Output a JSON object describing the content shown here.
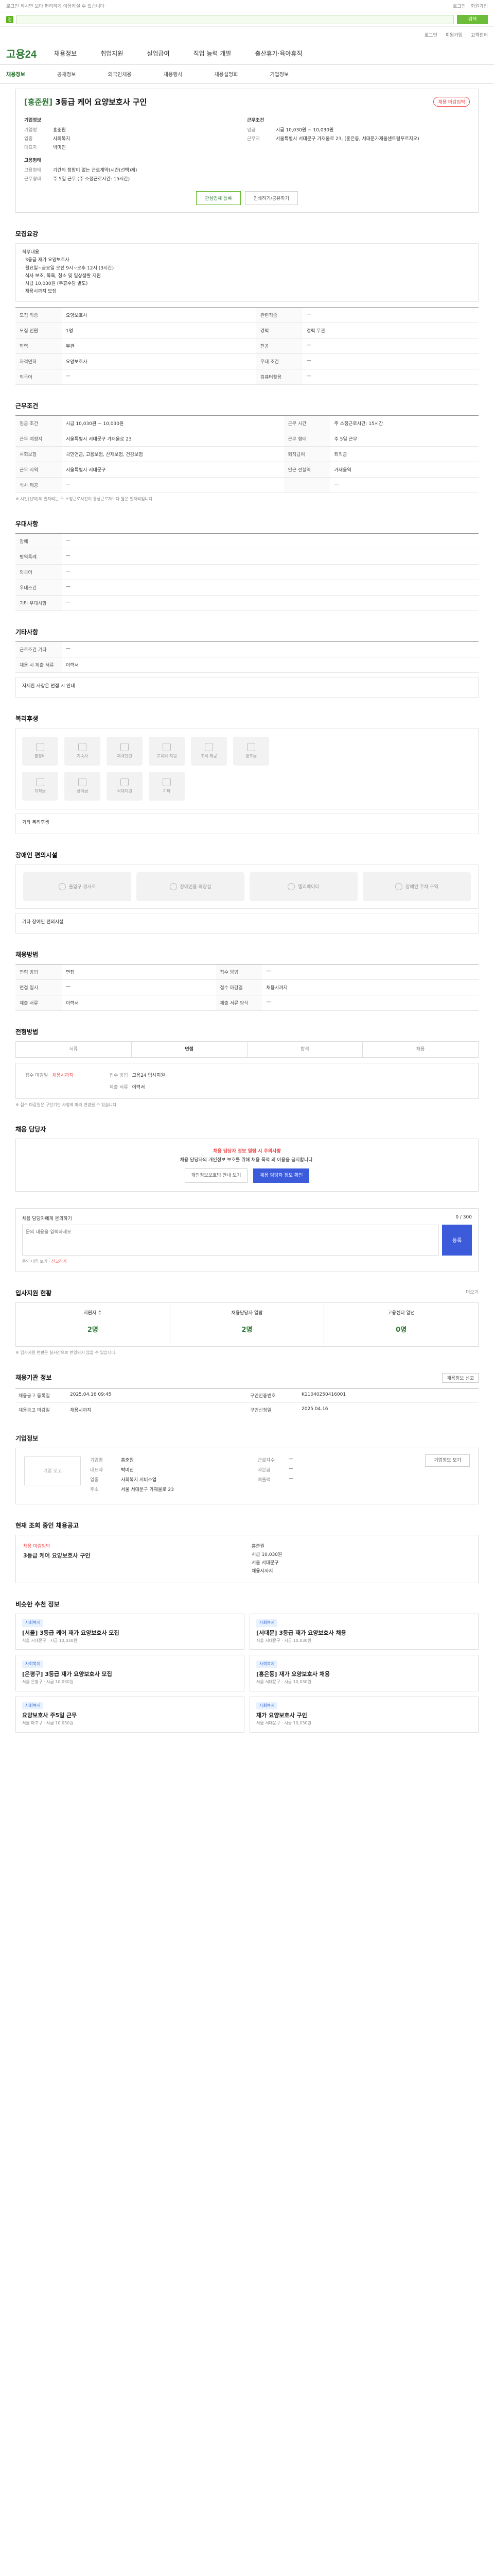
{
  "utility": {
    "left": "로그인 하시면 보다 편리하게 이용하실 수 있습니다",
    "links": [
      "로그인",
      "회원가입"
    ]
  },
  "gbar": {
    "placeholder": "",
    "btn": "검색"
  },
  "hdr": {
    "links": [
      "로그인",
      "회원가입",
      "고객센터"
    ]
  },
  "logo": "고용24",
  "nav": [
    "채용정보",
    "취업지원",
    "실업급여",
    "직업 능력 개발",
    "출산휴가·육아휴직"
  ],
  "subnav": [
    "채용정보",
    "공채정보",
    "외국인채용",
    "채용행사",
    "채용설명회",
    "기업정보"
  ],
  "job": {
    "tag": "[홍준원]",
    "title": "3등급 케어 요양보호사 구인",
    "badge": "채용 마감임박",
    "corp_h": "기업정보",
    "corp": [
      {
        "k": "기업명",
        "v": "홍준원"
      },
      {
        "k": "업종",
        "v": "사회복지"
      },
      {
        "k": "대표자",
        "v": "박미진"
      }
    ],
    "work_h": "근무조건",
    "work": [
      {
        "k": "임금",
        "v": "시급 10,030원 ~ 10,030원"
      },
      {
        "k": "근무지",
        "v": "서울특별시 서대문구 가재울로 23, (홍은동, 서대문가재울센트럴푸르지오)"
      }
    ],
    "req_h": "고용형태",
    "req": [
      {
        "k": "고용형태",
        "v": "기간의 정함이 없는 근로계약(시간(선택)제)"
      },
      {
        "k": "근무형태",
        "v": "주 5일 근무 (주 소정근로시간: 15시간)"
      }
    ],
    "btn1": "관심업체 등록",
    "btn2": "인쇄하기/공유하기"
  },
  "dutySec": {
    "h": "모집요강",
    "intro": "직무내용",
    "items": [
      "· 3등급 재가 요양보호사",
      "· 월요일~금요일 오전 9시~오후 12시 (3시간)",
      "· 식사 보조, 목욕, 청소 및 일상생활 지원",
      "· 시급 10,030원 (주휴수당 별도)",
      "· 채용시까지 모집"
    ],
    "rows": [
      [
        "모집 직종",
        "요양보호사",
        "관련직종",
        "—"
      ],
      [
        "모집 인원",
        "1명",
        "경력",
        "경력 무관"
      ],
      [
        "학력",
        "무관",
        "전공",
        "—"
      ],
      [
        "자격면허",
        "요양보호사",
        "우대 조건",
        "—"
      ],
      [
        "외국어",
        "—",
        "컴퓨터활용",
        "—"
      ]
    ]
  },
  "condSec": {
    "h": "근무조건",
    "rows": [
      [
        "임금 조건",
        "시급 10,030원 ~ 10,030원",
        "근무 시간",
        "주 소정근로시간: 15시간"
      ],
      [
        "근무 예정지",
        "서울특별시 서대문구 가재울로 23",
        "근무 형태",
        "주 5일 근무"
      ],
      [
        "사회보험",
        "국민연금, 고용보험, 산재보험, 건강보험",
        "퇴직급여",
        "퇴직금"
      ],
      [
        "근무 지역",
        "서울특별시 서대문구",
        "인근 전철역",
        "가재울역"
      ],
      [
        "식사 제공",
        "—",
        "",
        "—"
      ]
    ],
    "note": "※ 시간(선택)제 일자리는 주 소정근로시간이 통상근로자보다 짧은 일자리입니다."
  },
  "etcSec": {
    "h": "우대사항",
    "rows": [
      [
        "장애",
        "—"
      ],
      [
        "병역특례",
        "—"
      ],
      [
        "외국어",
        "—"
      ],
      [
        "우대조건",
        "—"
      ],
      [
        "기타 우대사항",
        "—"
      ]
    ]
  },
  "otherSec": {
    "h": "기타사항",
    "rows": [
      [
        "근로조건 기타",
        "—"
      ],
      [
        "채용 시 제출 서류",
        "이력서"
      ]
    ],
    "note": "자세한 사항은 면접 시 안내"
  },
  "welSec": {
    "h": "복리후생",
    "items": [
      "출장비",
      "기숙사",
      "체력단련",
      "교육비 지원",
      "조식 제공",
      "경조금",
      "퇴직금",
      "상여금",
      "식대지원",
      "기타"
    ],
    "note": "기타 복리후생"
  },
  "disSec": {
    "h": "장애인 편의시설",
    "items": [
      "출입구 경사로",
      "장애인용 화장실",
      "엘리베이터",
      "장애인 주차 구역"
    ],
    "note": "기타 장애인 편의시설"
  },
  "intvSec": {
    "h": "채용방법",
    "rows": [
      [
        "전형 방법",
        "면접",
        "접수 방법",
        "—"
      ],
      [
        "면접 일시",
        "—",
        "접수 마감일",
        "채용시까지"
      ],
      [
        "제출 서류",
        "이력서",
        "제출 서류 양식",
        "—"
      ]
    ]
  },
  "steps": {
    "h": "전형방법",
    "items": [
      "서류",
      "면접",
      "합격",
      "채용"
    ]
  },
  "apply": {
    "k1": "접수 마감일",
    "v1": "채용시까지",
    "k2": "접수 방법",
    "v2": "고용24 입사지원",
    "k3": "제출 서류",
    "v3": "이력서",
    "note": "※ 접수 마감일은 구인기관 사정에 따라 변경될 수 있습니다."
  },
  "contact": {
    "h": "채용 담당자",
    "warn": "채용 담당자 정보 열람 시 주의사항",
    "body": "채용 담당자의 개인정보 보호를 위해 채용 목적 외 이용을 금지합니다.",
    "b1": "개인정보보호법 안내 보기",
    "b2": "채용 담당자 정보 확인"
  },
  "inq": {
    "h": "채용 담당자에게 문의하기",
    "count": "0 / 300",
    "placeholder": "문의 내용을 입력하세요",
    "send": "등록",
    "links": [
      "문의 내역 보기",
      "신고하기"
    ]
  },
  "stats": {
    "h": "입사지원 현황",
    "more": "더보기",
    "items": [
      {
        "k": "지원자 수",
        "n": "2명"
      },
      {
        "k": "채용담당자 열람",
        "n": "2명"
      },
      {
        "k": "고용센터 알선",
        "n": "0명"
      }
    ],
    "note": "※ 입사지원 현황은 실시간으로 반영되지 않을 수 있습니다."
  },
  "meta": {
    "h": "채용기관 정보",
    "btn": "채용정보 신고",
    "rows": [
      [
        "채용공고 등록일",
        "2025.04.16 09:45",
        "구인인증번호",
        "K11040250416001"
      ],
      [
        "채용공고 마감일",
        "채용시까지",
        "구인신청일",
        "2025.04.16"
      ]
    ]
  },
  "org": {
    "h": "기업정보",
    "logo": "기업 로고",
    "btn": "기업정보 보기",
    "rows": [
      [
        "기업명",
        "홍준원"
      ],
      [
        "대표자",
        "박미진"
      ],
      [
        "업종",
        "사회복지 서비스업"
      ],
      [
        "주소",
        "서울 서대문구 가재울로 23"
      ]
    ],
    "rows2": [
      [
        "근로자수",
        "—"
      ],
      [
        "자본금",
        "—"
      ],
      [
        "매출액",
        "—"
      ]
    ]
  },
  "rel": {
    "h": "현재 조회 중인 채용공고",
    "tag": "채용 마감임박",
    "title": "3등급 케어 요양보호사 구인",
    "items": [
      "홍준원",
      "시급 10,030원",
      "서울 서대문구",
      "채용시까지"
    ]
  },
  "cards": {
    "h": "비슷한 추천 정보",
    "items": [
      {
        "pill": "사회복지",
        "title": "[서울] 3등급 케어 재가 요양보호사 모집",
        "meta": "서울 서대문구 · 시급 10,030원"
      },
      {
        "pill": "사회복지",
        "title": "[서대문] 3등급 재가 요양보호사 채용",
        "meta": "서울 서대문구 · 시급 10,030원"
      },
      {
        "pill": "사회복지",
        "title": "[은평구] 3등급 재가 요양보호사 모집",
        "meta": "서울 은평구 · 시급 10,030원"
      },
      {
        "pill": "사회복지",
        "title": "[홍은동] 재가 요양보호사 채용",
        "meta": "서울 서대문구 · 시급 10,030원"
      },
      {
        "pill": "사회복지",
        "title": "요양보호사 주5일 근무",
        "meta": "서울 마포구 · 시급 10,030원"
      },
      {
        "pill": "사회복지",
        "title": "재가 요양보호사 구인",
        "meta": "서울 서대문구 · 시급 10,030원"
      }
    ]
  }
}
